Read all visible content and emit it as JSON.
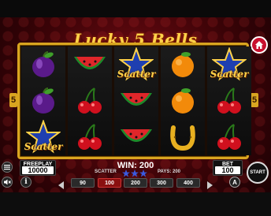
{
  "game": {
    "title": "Lucky 5 Bells"
  },
  "reels": [
    [
      "plum",
      "plum",
      "scatter-star"
    ],
    [
      "watermelon",
      "cherries",
      "cherries"
    ],
    [
      "scatter-star",
      "watermelon",
      "watermelon"
    ],
    [
      "orange",
      "orange",
      "horseshoe"
    ],
    [
      "scatter-star",
      "cherries",
      "cherries"
    ]
  ],
  "scatter_text": "Scatter",
  "side_lines": {
    "left": "5",
    "right": "5"
  },
  "freeplay": {
    "label": "FREEPLAY",
    "value": "10000"
  },
  "bet": {
    "label": "BET",
    "value": "100"
  },
  "win": {
    "text": "WIN: 200"
  },
  "scatter_info": {
    "label": "SCATTER",
    "pays_text": "PAYS: 200"
  },
  "bet_options": [
    "90",
    "100",
    "200",
    "300",
    "400"
  ],
  "bet_selected": "100",
  "buttons": {
    "start": "START",
    "autoplay": "A",
    "info": "i"
  },
  "colors": {
    "gold": "#d9a520",
    "accent_red": "#c8102e",
    "scatter_yellow": "#ffd24a"
  }
}
